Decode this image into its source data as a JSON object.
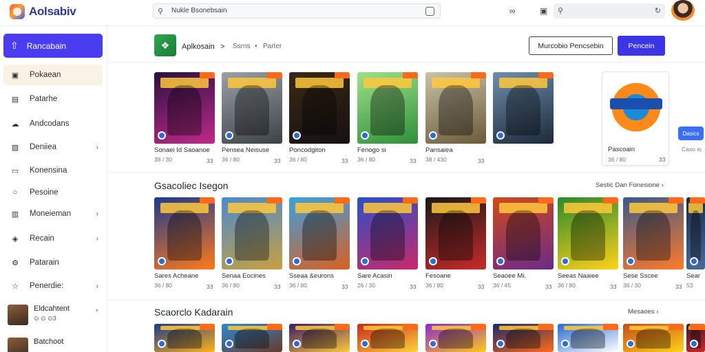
{
  "brand": {
    "name": "Aolsabiv"
  },
  "topbar": {
    "search_value": "Nukle Bsonebsain",
    "right_search_placeholder": ""
  },
  "sidebar": {
    "primary_label": "Rancabain",
    "items": [
      {
        "label": "Pokaean",
        "icon": "box-icon",
        "chevron": false,
        "active": true
      },
      {
        "label": "Patarhe",
        "icon": "file-icon",
        "chevron": false
      },
      {
        "label": "Andcodans",
        "icon": "cloud-icon",
        "chevron": false
      },
      {
        "label": "Deniiea",
        "icon": "image-icon",
        "chevron": true
      },
      {
        "label": "Konensina",
        "icon": "monitor-icon",
        "chevron": false
      },
      {
        "label": "Pesoine",
        "icon": "chat-icon",
        "chevron": false
      },
      {
        "label": "Moneieman",
        "icon": "window-icon",
        "chevron": true
      },
      {
        "label": "Recain",
        "icon": "gamepad-icon",
        "chevron": true
      },
      {
        "label": "Patarain",
        "icon": "gear-icon",
        "chevron": false
      },
      {
        "label": "Penerdie:",
        "icon": "star-icon",
        "chevron": true
      }
    ],
    "users": [
      {
        "name": "Eldcahtent",
        "status": "⊙ ⊙ ⊙3"
      },
      {
        "name": "Batchoot",
        "status": ""
      }
    ]
  },
  "header": {
    "app_name": "Aplkosain",
    "crumb_sep": ">",
    "crumb_1": "Ssrns",
    "crumb_dot": "•",
    "crumb_2": "Parter",
    "outline_button": "Murcobio Pencsebin",
    "solid_button": "Pencein"
  },
  "row1": {
    "cards": [
      {
        "title": "Sonaei Id Saoanoe",
        "meta": "38 / 30",
        "num": "33",
        "colors": [
          "#2a1140",
          "#c02a8a"
        ]
      },
      {
        "title": "Pensea Neisuse",
        "meta": "36 / 80",
        "num": "33",
        "colors": [
          "#9aa0a6",
          "#3d4148"
        ]
      },
      {
        "title": "Poncodgiton",
        "meta": "36 / 80",
        "num": "33",
        "colors": [
          "#3a2a14",
          "#151012"
        ]
      },
      {
        "title": "Fenogo si",
        "meta": "36 / 80",
        "num": "33",
        "colors": [
          "#9ee08a",
          "#2f8f3a"
        ]
      },
      {
        "title": "Pansaiea",
        "meta": "38 / 430",
        "num": "33",
        "colors": [
          "#c9c2a8",
          "#6b5a3a"
        ]
      },
      {
        "title": "",
        "meta": "",
        "num": "",
        "colors": [
          "#6f8dad",
          "#1c2a3a"
        ]
      }
    ],
    "featured": {
      "title": "Pascoain",
      "meta": "36 / 80",
      "num": "33",
      "button": "Dasics"
    },
    "side_meta": "Caso io"
  },
  "row2": {
    "title": "Gsacoliec Isegon",
    "link": "Sestic Dan Fonesione",
    "cards": [
      {
        "title": "Sares Acheane",
        "meta": "36 / 80",
        "num": "33",
        "colors": [
          "#1b3a8f",
          "#ff7a1a"
        ]
      },
      {
        "title": "Senaa Eocines",
        "meta": "36 / 80",
        "num": "33",
        "colors": [
          "#4a8ad0",
          "#c8a040"
        ]
      },
      {
        "title": "Sseaa &eurons",
        "meta": "36 / 80",
        "num": "33",
        "colors": [
          "#3aa0e0",
          "#d96020"
        ]
      },
      {
        "title": "Sare Acasin",
        "meta": "26 / 30",
        "num": "33",
        "colors": [
          "#2a4fc8",
          "#c82a6a"
        ]
      },
      {
        "title": "Fesoane",
        "meta": "36 / 80",
        "num": "33",
        "colors": [
          "#1a1a1a",
          "#c82a2a"
        ]
      },
      {
        "title": "Seaoee Mi.",
        "meta": "36 / 45",
        "num": "33",
        "colors": [
          "#d04a1a",
          "#6a2a8a"
        ]
      },
      {
        "title": "Seeas Naaiee",
        "meta": "36 / 80",
        "num": "33",
        "colors": [
          "#2a8a2a",
          "#ffd21a"
        ]
      },
      {
        "title": "Sese Sscee",
        "meta": "36 / 30",
        "num": "33",
        "colors": [
          "#3a5a8a",
          "#ff7a2a"
        ]
      },
      {
        "title": "Sear",
        "meta": "53",
        "num": "",
        "colors": [
          "#1a2a4a",
          "#4a6a9a"
        ]
      }
    ]
  },
  "row3": {
    "title": "Scaorclo Kadarain",
    "link": "Mesaoes",
    "cards": [
      {
        "colors": [
          "#1c3a8a",
          "#ffb21a"
        ]
      },
      {
        "colors": [
          "#2a8ad0",
          "#6a3a2a"
        ]
      },
      {
        "colors": [
          "#3a1a6a",
          "#ffc83a"
        ]
      },
      {
        "colors": [
          "#c82a1a",
          "#ffd23a"
        ]
      },
      {
        "colors": [
          "#8a2ad0",
          "#ffc81a"
        ]
      },
      {
        "colors": [
          "#1a2a6a",
          "#ff6a1a"
        ]
      },
      {
        "colors": [
          "#2a6ad0",
          "#ffffff"
        ]
      },
      {
        "colors": [
          "#c84a1a",
          "#ffd21a"
        ]
      },
      {
        "colors": [
          "#3a1a2a",
          "#c82a2a"
        ]
      }
    ]
  },
  "accent": "#4a3cf0"
}
